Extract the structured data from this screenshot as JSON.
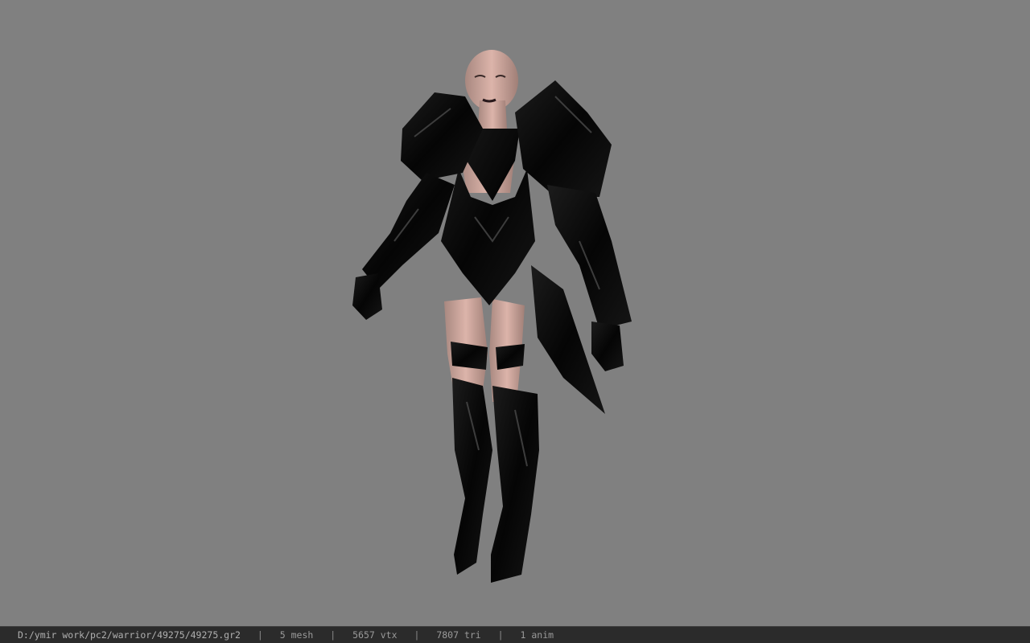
{
  "viewport": {
    "background_color": "#808080",
    "model_icon": "armored-character-model"
  },
  "statusbar": {
    "file_path": "D:/ymir work/pc2/warrior/49275/49275.gr2",
    "separator": "|",
    "mesh_count": "5 mesh",
    "vertex_count": "5657 vtx",
    "triangle_count": "7807 tri",
    "anim_count": "1 anim",
    "background_color": "#2b2b2b",
    "text_color": "#9a9a9a"
  }
}
